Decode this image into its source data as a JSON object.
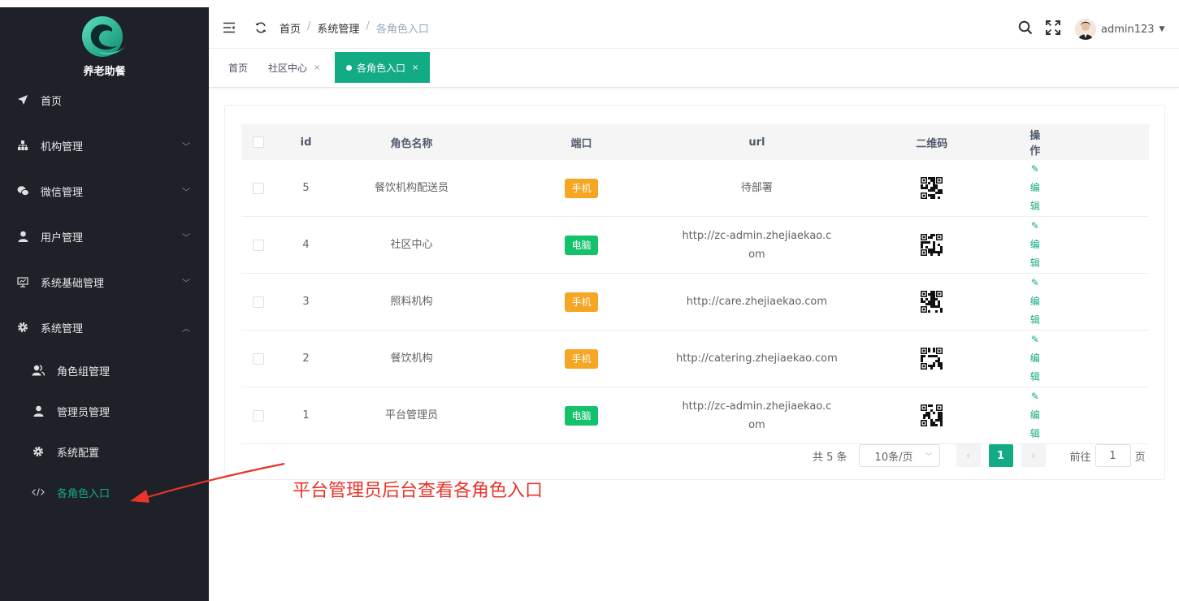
{
  "app": {
    "name": "养老助餐"
  },
  "sidebar": {
    "items": [
      {
        "label": "首页",
        "icon": "paper-plane-icon"
      },
      {
        "label": "机构管理",
        "icon": "sitemap-icon"
      },
      {
        "label": "微信管理",
        "icon": "wechat-icon"
      },
      {
        "label": "用户管理",
        "icon": "user-icon"
      },
      {
        "label": "系统基础管理",
        "icon": "monitor-icon"
      },
      {
        "label": "系统管理",
        "icon": "gear-icon"
      }
    ],
    "sub_items": [
      {
        "label": "角色组管理",
        "icon": "users-icon"
      },
      {
        "label": "管理员管理",
        "icon": "user-icon"
      },
      {
        "label": "系统配置",
        "icon": "gear-icon"
      },
      {
        "label": "各角色入口",
        "icon": "code-icon"
      }
    ]
  },
  "header": {
    "breadcrumb": [
      "首页",
      "系统管理",
      "各角色入口"
    ],
    "sep": "/",
    "username": "admin123"
  },
  "tabs": [
    {
      "label": "首页"
    },
    {
      "label": "社区中心",
      "close": "×"
    },
    {
      "label": "各角色入口",
      "close": "×",
      "active": true
    }
  ],
  "table": {
    "columns": [
      "id",
      "角色名称",
      "端口",
      "url",
      "二维码",
      "操作"
    ],
    "rows": [
      {
        "id": "5",
        "name": "餐饮机构配送员",
        "port": "手机",
        "url": "待部署",
        "action": "编辑"
      },
      {
        "id": "4",
        "name": "社区中心",
        "port": "电脑",
        "url": "http://zc-admin.zhejiaekao.com",
        "action": "编辑"
      },
      {
        "id": "3",
        "name": "照料机构",
        "port": "手机",
        "url": "http://care.zhejiaekao.com",
        "action": "编辑"
      },
      {
        "id": "2",
        "name": "餐饮机构",
        "port": "手机",
        "url": "http://catering.zhejiaekao.com",
        "action": "编辑"
      },
      {
        "id": "1",
        "name": "平台管理员",
        "port": "电脑",
        "url": "http://zc-admin.zhejiaekao.com",
        "action": "编辑"
      }
    ]
  },
  "pagination": {
    "total": "共 5 条",
    "page_size": "10条/页",
    "current": "1",
    "goto_prefix": "前往",
    "goto_value": "1",
    "goto_suffix": "页"
  },
  "annotation": "平台管理员后台查看各角色入口",
  "colors": {
    "accent": "#13ab84",
    "sidebar": "#1f2128",
    "mobile": "#f5a623",
    "pc": "#13c26a",
    "annotation": "#e8342a"
  }
}
